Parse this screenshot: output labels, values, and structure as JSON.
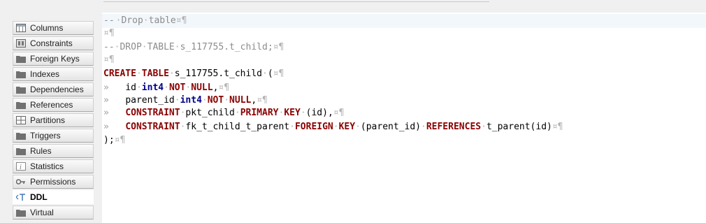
{
  "sidebar": {
    "items": [
      {
        "label": "Columns",
        "icon": "columns-icon"
      },
      {
        "label": "Constraints",
        "icon": "constraints-icon"
      },
      {
        "label": "Foreign Keys",
        "icon": "folder-icon"
      },
      {
        "label": "Indexes",
        "icon": "folder-icon"
      },
      {
        "label": "Dependencies",
        "icon": "folder-icon"
      },
      {
        "label": "References",
        "icon": "folder-icon"
      },
      {
        "label": "Partitions",
        "icon": "partitions-icon"
      },
      {
        "label": "Triggers",
        "icon": "folder-icon"
      },
      {
        "label": "Rules",
        "icon": "folder-icon"
      },
      {
        "label": "Statistics",
        "icon": "info-icon"
      },
      {
        "label": "Permissions",
        "icon": "key-icon"
      },
      {
        "label": "DDL",
        "icon": "ddl-icon",
        "active": true
      },
      {
        "label": "Virtual",
        "icon": "folder-icon"
      }
    ]
  },
  "editor": {
    "line1_comment": "-- Drop table",
    "line3_comment": "-- DROP TABLE s_117755.t_child;",
    "line5": {
      "kw1": "CREATE",
      "kw2": "TABLE",
      "name": "s_117755.t_child",
      "paren": "("
    },
    "line6": {
      "col": "id",
      "type": "int4",
      "kw1": "NOT",
      "kw2": "NULL",
      "tail": ","
    },
    "line7": {
      "col": "parent_id",
      "type": "int4",
      "kw1": "NOT",
      "kw2": "NULL",
      "tail": ","
    },
    "line8": {
      "kw1": "CONSTRAINT",
      "name": "pkt_child",
      "kw2": "PRIMARY",
      "kw3": "KEY",
      "rest": "(id),"
    },
    "line9": {
      "kw1": "CONSTRAINT",
      "name": "fk_t_child_t_parent",
      "kw2": "FOREIGN",
      "kw3": "KEY",
      "rest": "(parent_id)",
      "kw4": "REFERENCES",
      "ref": "t_parent(id)"
    },
    "line10": ");",
    "eol_marker": "¤¶",
    "space_marker": "·",
    "tab_marker": "»"
  },
  "colors": {
    "comment": "#8c8c8c",
    "keyword": "#8b0000",
    "type": "#00008b",
    "current_line": "#f2f7fc"
  }
}
